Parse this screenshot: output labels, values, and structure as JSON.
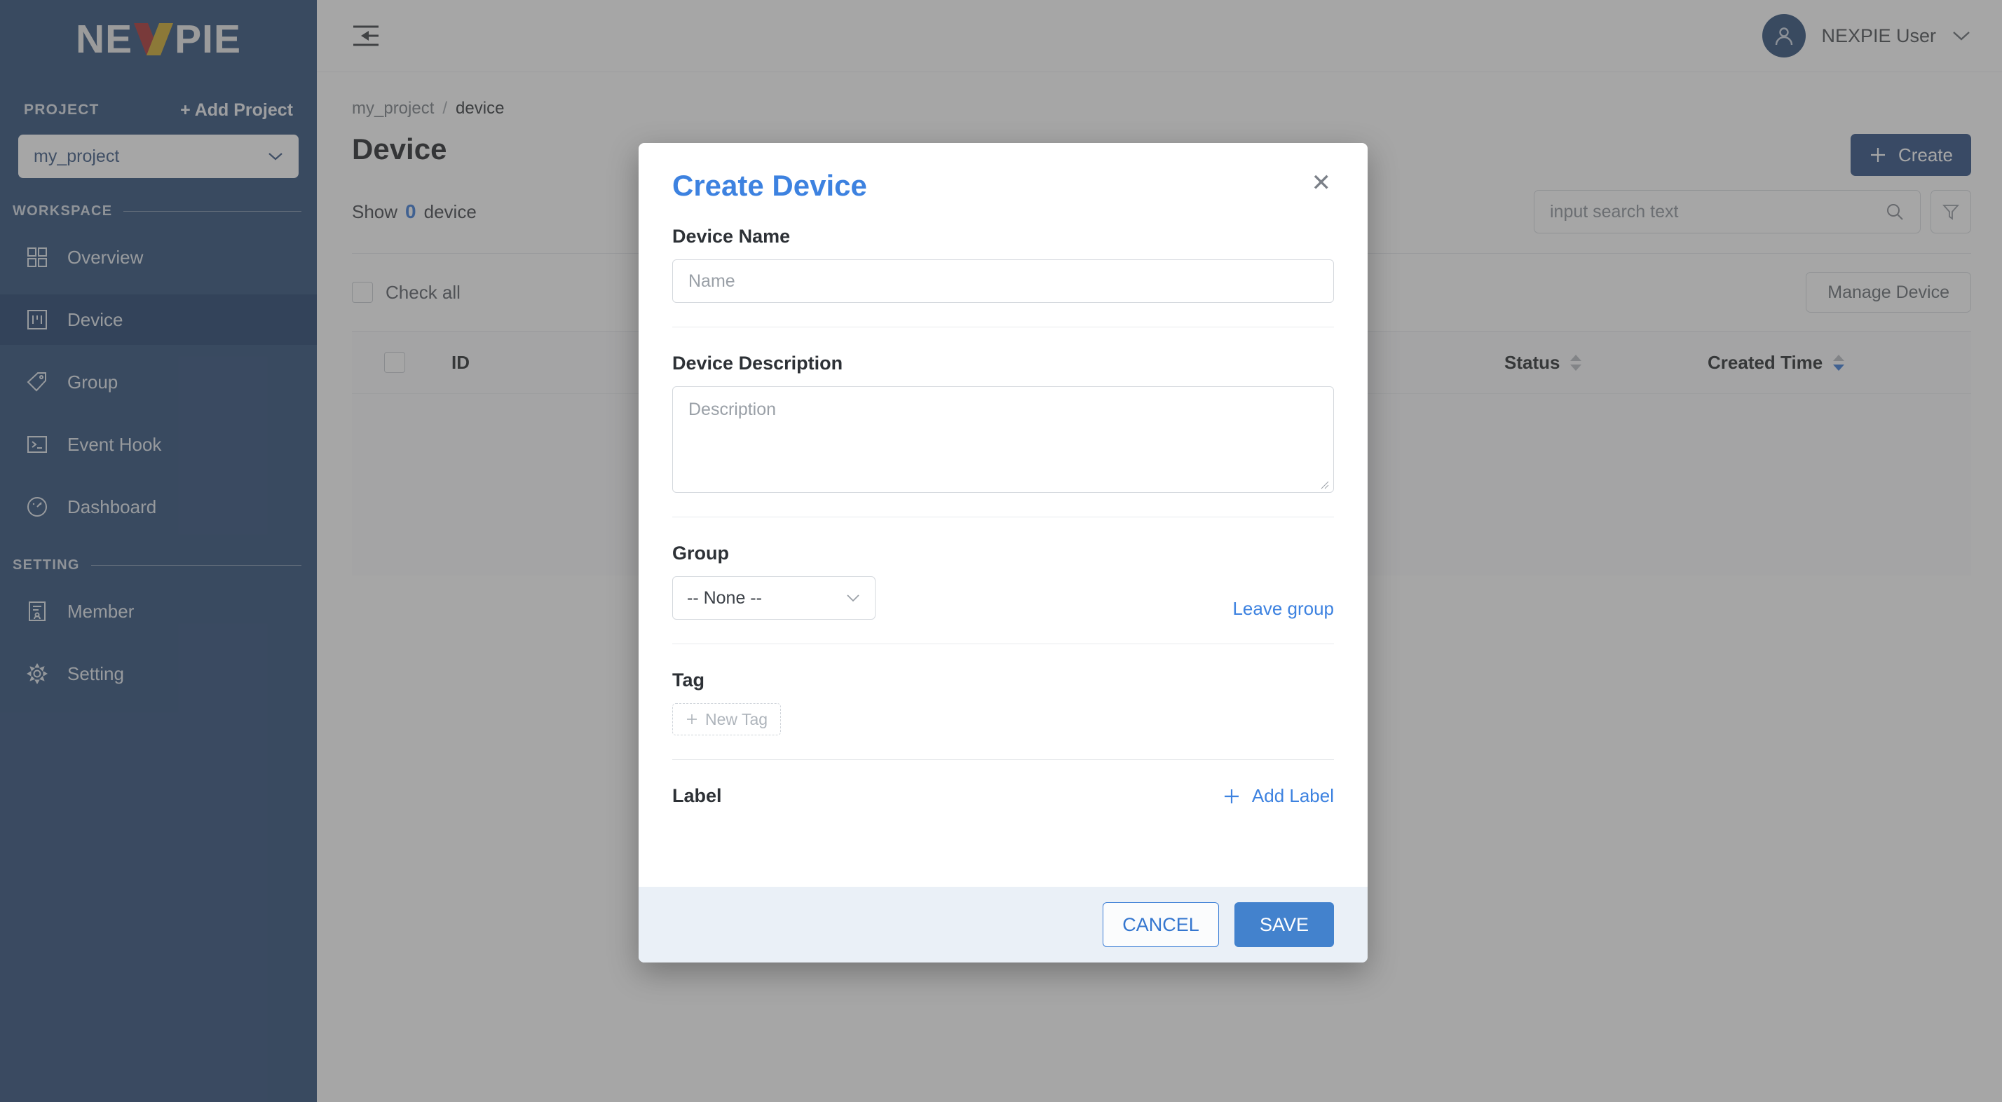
{
  "brand": {
    "logo_text_1": "NE",
    "logo_text_2": "PIE",
    "logo_x_left_color": "#a11f1f",
    "logo_x_right_color": "#c9a21a"
  },
  "sidebar": {
    "project_section_label": "PROJECT",
    "add_project_label": "+ Add Project",
    "project_selected": "my_project",
    "workspace_section_label": "WORKSPACE",
    "setting_section_label": "SETTING",
    "workspace_items": [
      {
        "label": "Overview",
        "icon": "grid-icon",
        "active": false
      },
      {
        "label": "Device",
        "icon": "device-icon",
        "active": true
      },
      {
        "label": "Group",
        "icon": "tag-icon",
        "active": false
      },
      {
        "label": "Event Hook",
        "icon": "terminal-icon",
        "active": false
      },
      {
        "label": "Dashboard",
        "icon": "gauge-icon",
        "active": false
      }
    ],
    "setting_items": [
      {
        "label": "Member",
        "icon": "member-icon",
        "active": false
      },
      {
        "label": "Setting",
        "icon": "gear-icon",
        "active": false
      }
    ],
    "bg_color": "#1d3f6e",
    "active_bg_color": "#0f3160"
  },
  "topbar": {
    "collapse_icon": "menu-collapse-icon",
    "user_name": "NEXPIE User",
    "avatar_icon": "person-icon",
    "chevron_icon": "chevron-down-icon"
  },
  "breadcrumb": {
    "project": "my_project",
    "separator": "/",
    "current": "device"
  },
  "page": {
    "title": "Device",
    "show_prefix": "Show",
    "show_count": "0",
    "show_suffix": "device",
    "create_button": "Create",
    "create_icon": "plus-icon",
    "search_placeholder": "input search text",
    "search_icon": "search-icon",
    "filter_icon": "filter-icon",
    "check_all_label": "Check all",
    "manage_device_button": "Manage Device",
    "create_button_color": "#1d4077",
    "accent_color": "#2b6fd4"
  },
  "table": {
    "columns": [
      {
        "key": "checkbox",
        "label": ""
      },
      {
        "key": "id",
        "label": "ID"
      },
      {
        "key": "status",
        "label": "Status",
        "sortable": true,
        "sort": "none"
      },
      {
        "key": "created",
        "label": "Created Time",
        "sortable": true,
        "sort": "desc"
      }
    ],
    "rows": []
  },
  "modal": {
    "title": "Create Device",
    "close_icon": "close-icon",
    "device_name_label": "Device Name",
    "device_name_value": "",
    "device_name_placeholder": "Name",
    "device_description_label": "Device Description",
    "device_description_value": "",
    "device_description_placeholder": "Description",
    "group_label": "Group",
    "group_selected": "-- None --",
    "group_chevron_icon": "chevron-down-icon",
    "leave_group_label": "Leave group",
    "tag_label": "Tag",
    "new_tag_label": "New Tag",
    "new_tag_icon": "plus-icon",
    "label_label": "Label",
    "add_label_label": "Add Label",
    "add_label_icon": "plus-icon",
    "cancel_button": "CANCEL",
    "save_button": "SAVE",
    "title_color": "#3d82e0",
    "save_color": "#4382cd",
    "footer_bg": "#eaf0f7"
  }
}
